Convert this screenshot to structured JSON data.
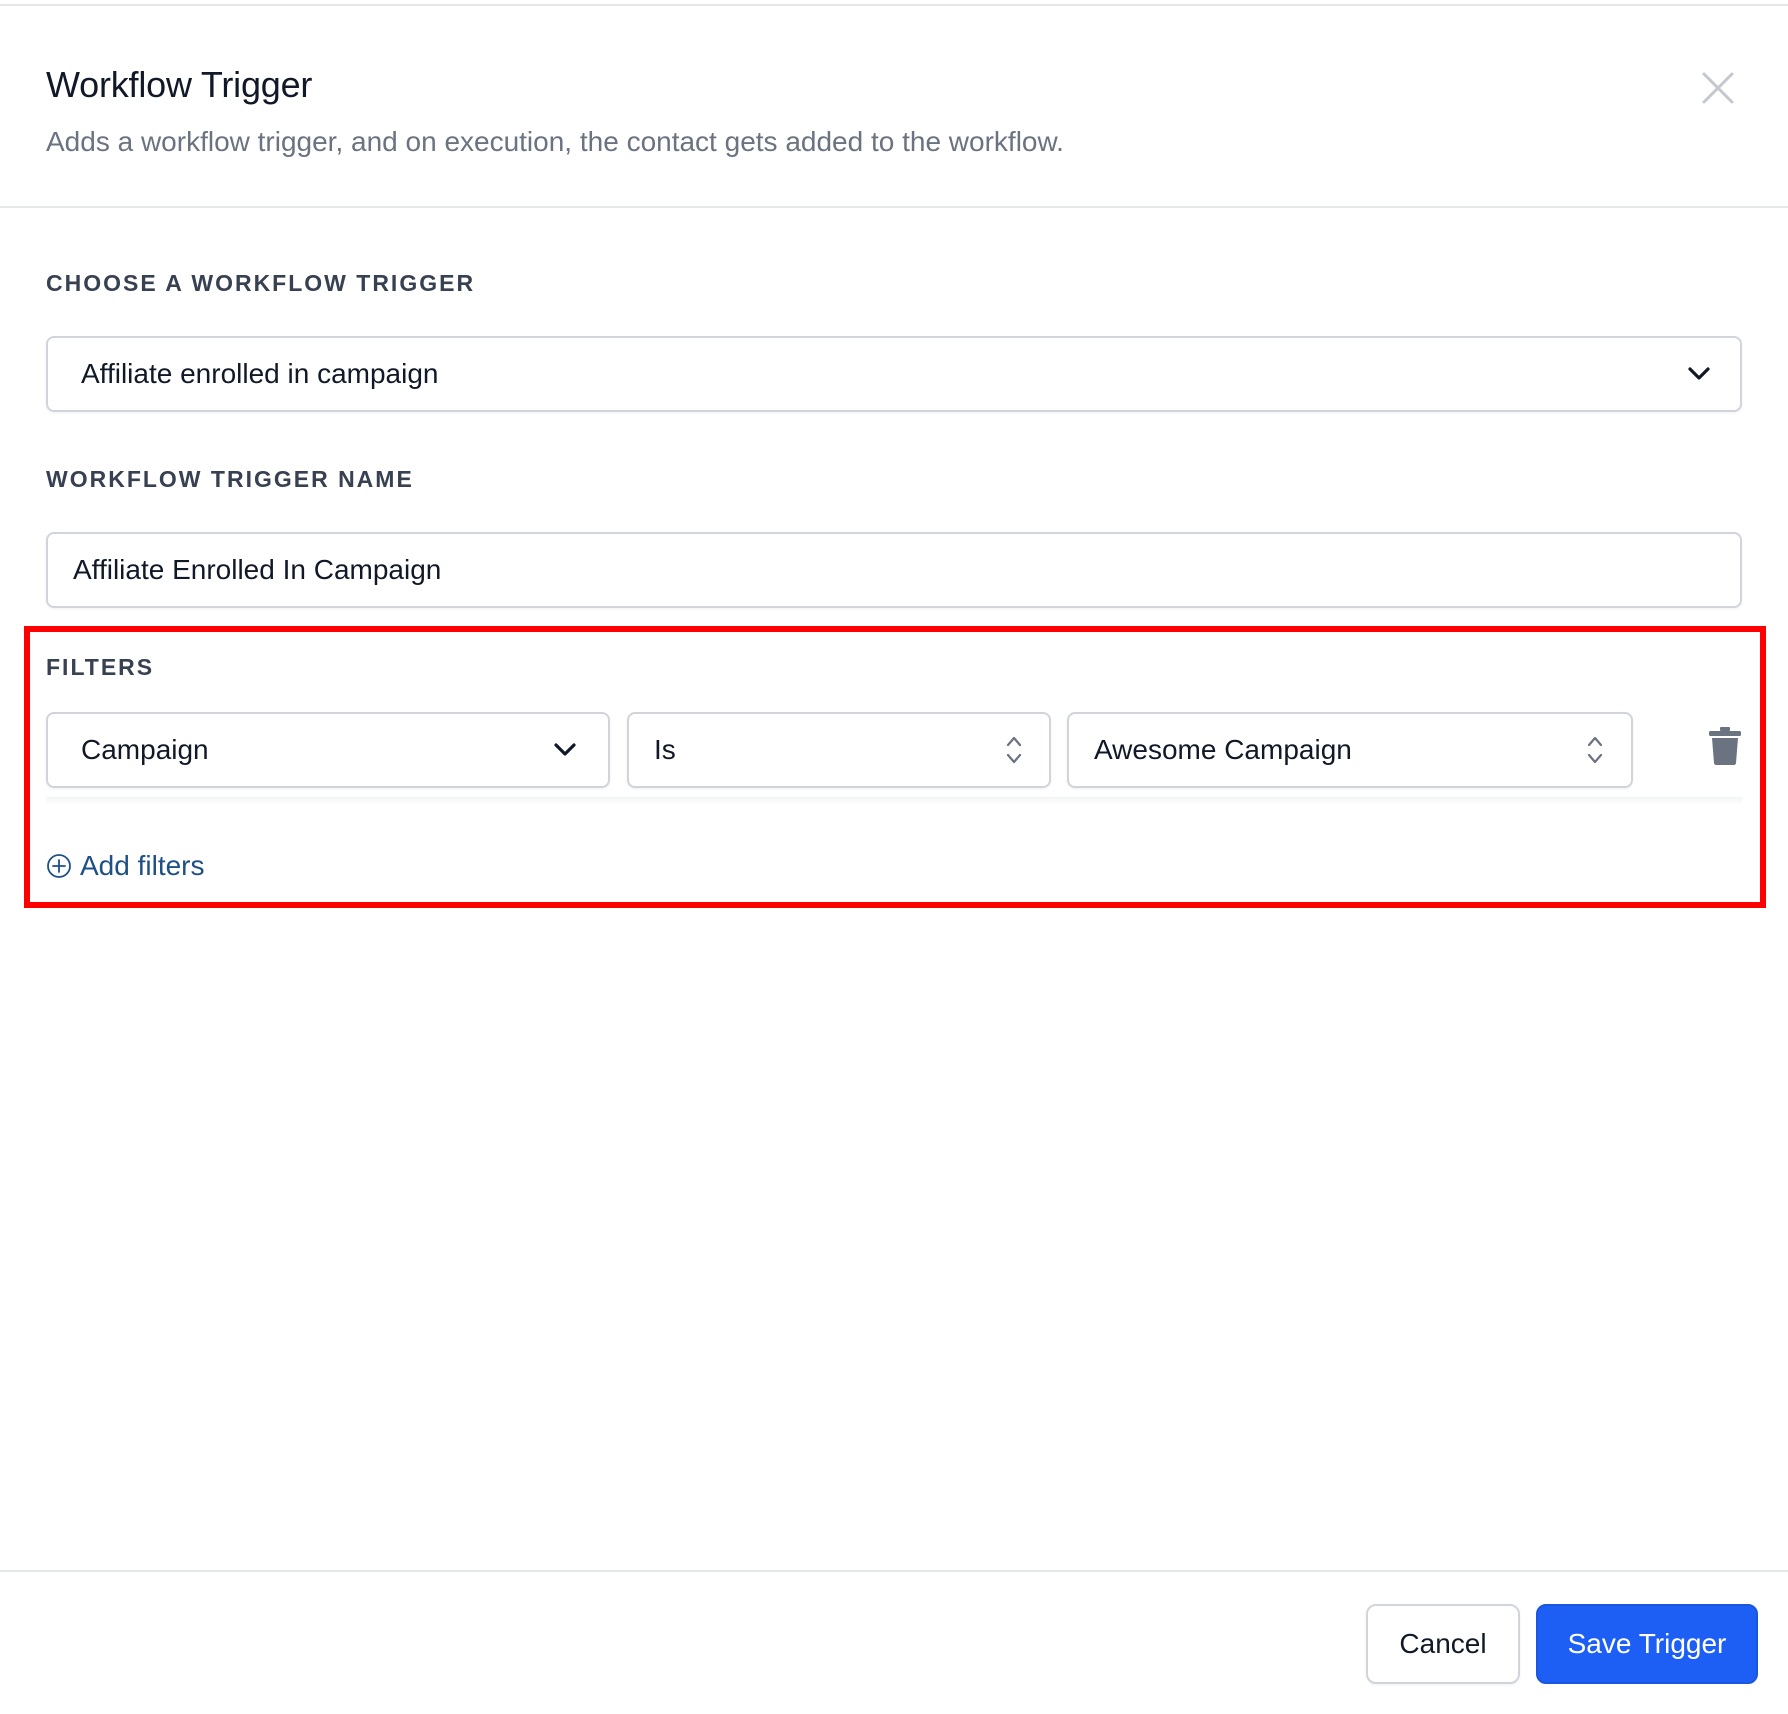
{
  "dialog": {
    "title": "Workflow Trigger",
    "subtitle": "Adds a workflow trigger, and on execution, the contact gets added to the workflow."
  },
  "trigger_select": {
    "label": "CHOOSE A WORKFLOW TRIGGER",
    "selected": "Affiliate enrolled in campaign"
  },
  "trigger_name": {
    "label": "WORKFLOW TRIGGER NAME",
    "value": "Affiliate Enrolled In Campaign"
  },
  "filters": {
    "label": "FILTERS",
    "rows": [
      {
        "field": "Campaign",
        "operator": "Is",
        "value": "Awesome Campaign"
      }
    ],
    "add_label": "Add filters"
  },
  "footer": {
    "cancel_label": "Cancel",
    "save_label": "Save Trigger"
  },
  "colors": {
    "primary": "#1d5ff5",
    "link": "#1e4f86",
    "highlight": "#ff0000"
  },
  "icons": {
    "close": "close-icon",
    "dropdown": "chevron-down-icon",
    "select_updown": "chevron-up-down-icon",
    "delete": "trash-icon",
    "add": "plus-circle-icon"
  }
}
